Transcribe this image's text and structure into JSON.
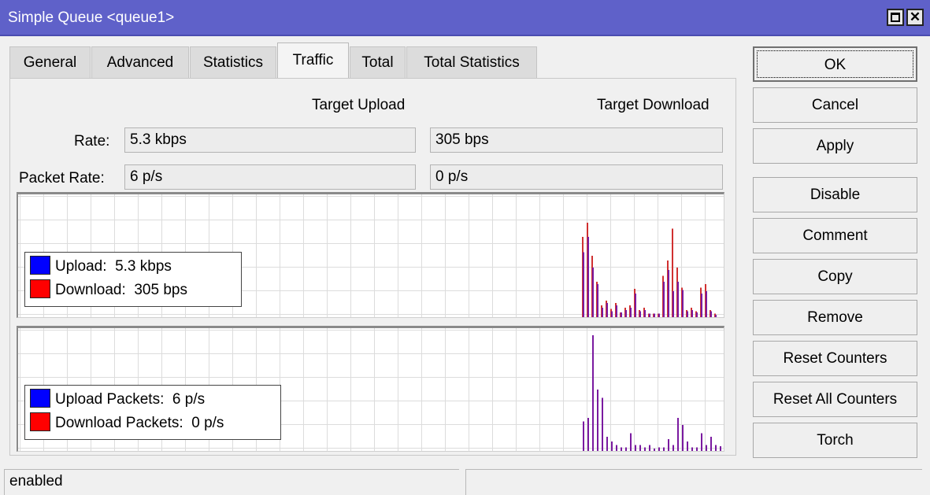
{
  "window": {
    "title": "Simple Queue <queue1>"
  },
  "tabs": [
    {
      "label": "General"
    },
    {
      "label": "Advanced"
    },
    {
      "label": "Statistics"
    },
    {
      "label": "Traffic",
      "active": true
    },
    {
      "label": "Total"
    },
    {
      "label": "Total Statistics"
    }
  ],
  "traffic": {
    "col_upload": "Target Upload",
    "col_download": "Target Download",
    "rate_label": "Rate:",
    "rate_upload": "5.3 kbps",
    "rate_download": "305 bps",
    "packet_rate_label": "Packet Rate:",
    "packet_rate_upload": "6 p/s",
    "packet_rate_download": "0 p/s"
  },
  "graphs": {
    "rate": {
      "legend": [
        {
          "label": "Upload:",
          "value": "5.3 kbps",
          "color": "#0000ff"
        },
        {
          "label": "Download:",
          "value": "305 bps",
          "color": "#ff0000"
        }
      ],
      "upload_series": [
        0.55,
        0.68,
        0.42,
        0.28,
        0.08,
        0.12,
        0.05,
        0.1,
        0.04,
        0.06,
        0.08,
        0.2,
        0.05,
        0.06,
        0.03,
        0.03,
        0.03,
        0.3,
        0.4,
        0.22,
        0.3,
        0.23,
        0.05,
        0.06,
        0.04,
        0.2,
        0.22,
        0.05,
        0.02
      ],
      "download_series": [
        0.68,
        0.8,
        0.52,
        0.3,
        0.1,
        0.14,
        0.07,
        0.12,
        0.04,
        0.08,
        0.1,
        0.24,
        0.06,
        0.08,
        0.03,
        0.03,
        0.03,
        0.35,
        0.48,
        0.75,
        0.42,
        0.25,
        0.06,
        0.08,
        0.05,
        0.25,
        0.28,
        0.06,
        0.03
      ]
    },
    "packets": {
      "legend": [
        {
          "label": "Upload Packets:",
          "value": "6 p/s",
          "color": "#0000ff"
        },
        {
          "label": "Download Packets:",
          "value": "0 p/s",
          "color": "#ff0000"
        }
      ],
      "upload_series": [
        0.25,
        0.28,
        0.98,
        0.52,
        0.45,
        0.12,
        0.08,
        0.05,
        0.03,
        0.03,
        0.15,
        0.05,
        0.05,
        0.03,
        0.05,
        0.02,
        0.03,
        0.03,
        0.1,
        0.05,
        0.28,
        0.22,
        0.08,
        0.03,
        0.03,
        0.15,
        0.05,
        0.12,
        0.05,
        0.04,
        0.03
      ],
      "download_series": [
        0.0,
        0.0,
        0.0,
        0.0,
        0.0,
        0.0,
        0.0,
        0.0,
        0.0,
        0.0,
        0.0,
        0.0,
        0.0,
        0.0,
        0.0,
        0.0,
        0.0,
        0.0,
        0.0,
        0.0,
        0.0,
        0.0,
        0.0,
        0.0,
        0.0,
        0.0,
        0.0,
        0.0,
        0.0,
        0.0,
        0.0
      ]
    }
  },
  "buttons": {
    "ok": "OK",
    "cancel": "Cancel",
    "apply": "Apply",
    "disable": "Disable",
    "comment": "Comment",
    "copy": "Copy",
    "remove": "Remove",
    "reset_counters": "Reset Counters",
    "reset_all_counters": "Reset All Counters",
    "torch": "Torch"
  },
  "status": {
    "left": "enabled",
    "right": ""
  }
}
